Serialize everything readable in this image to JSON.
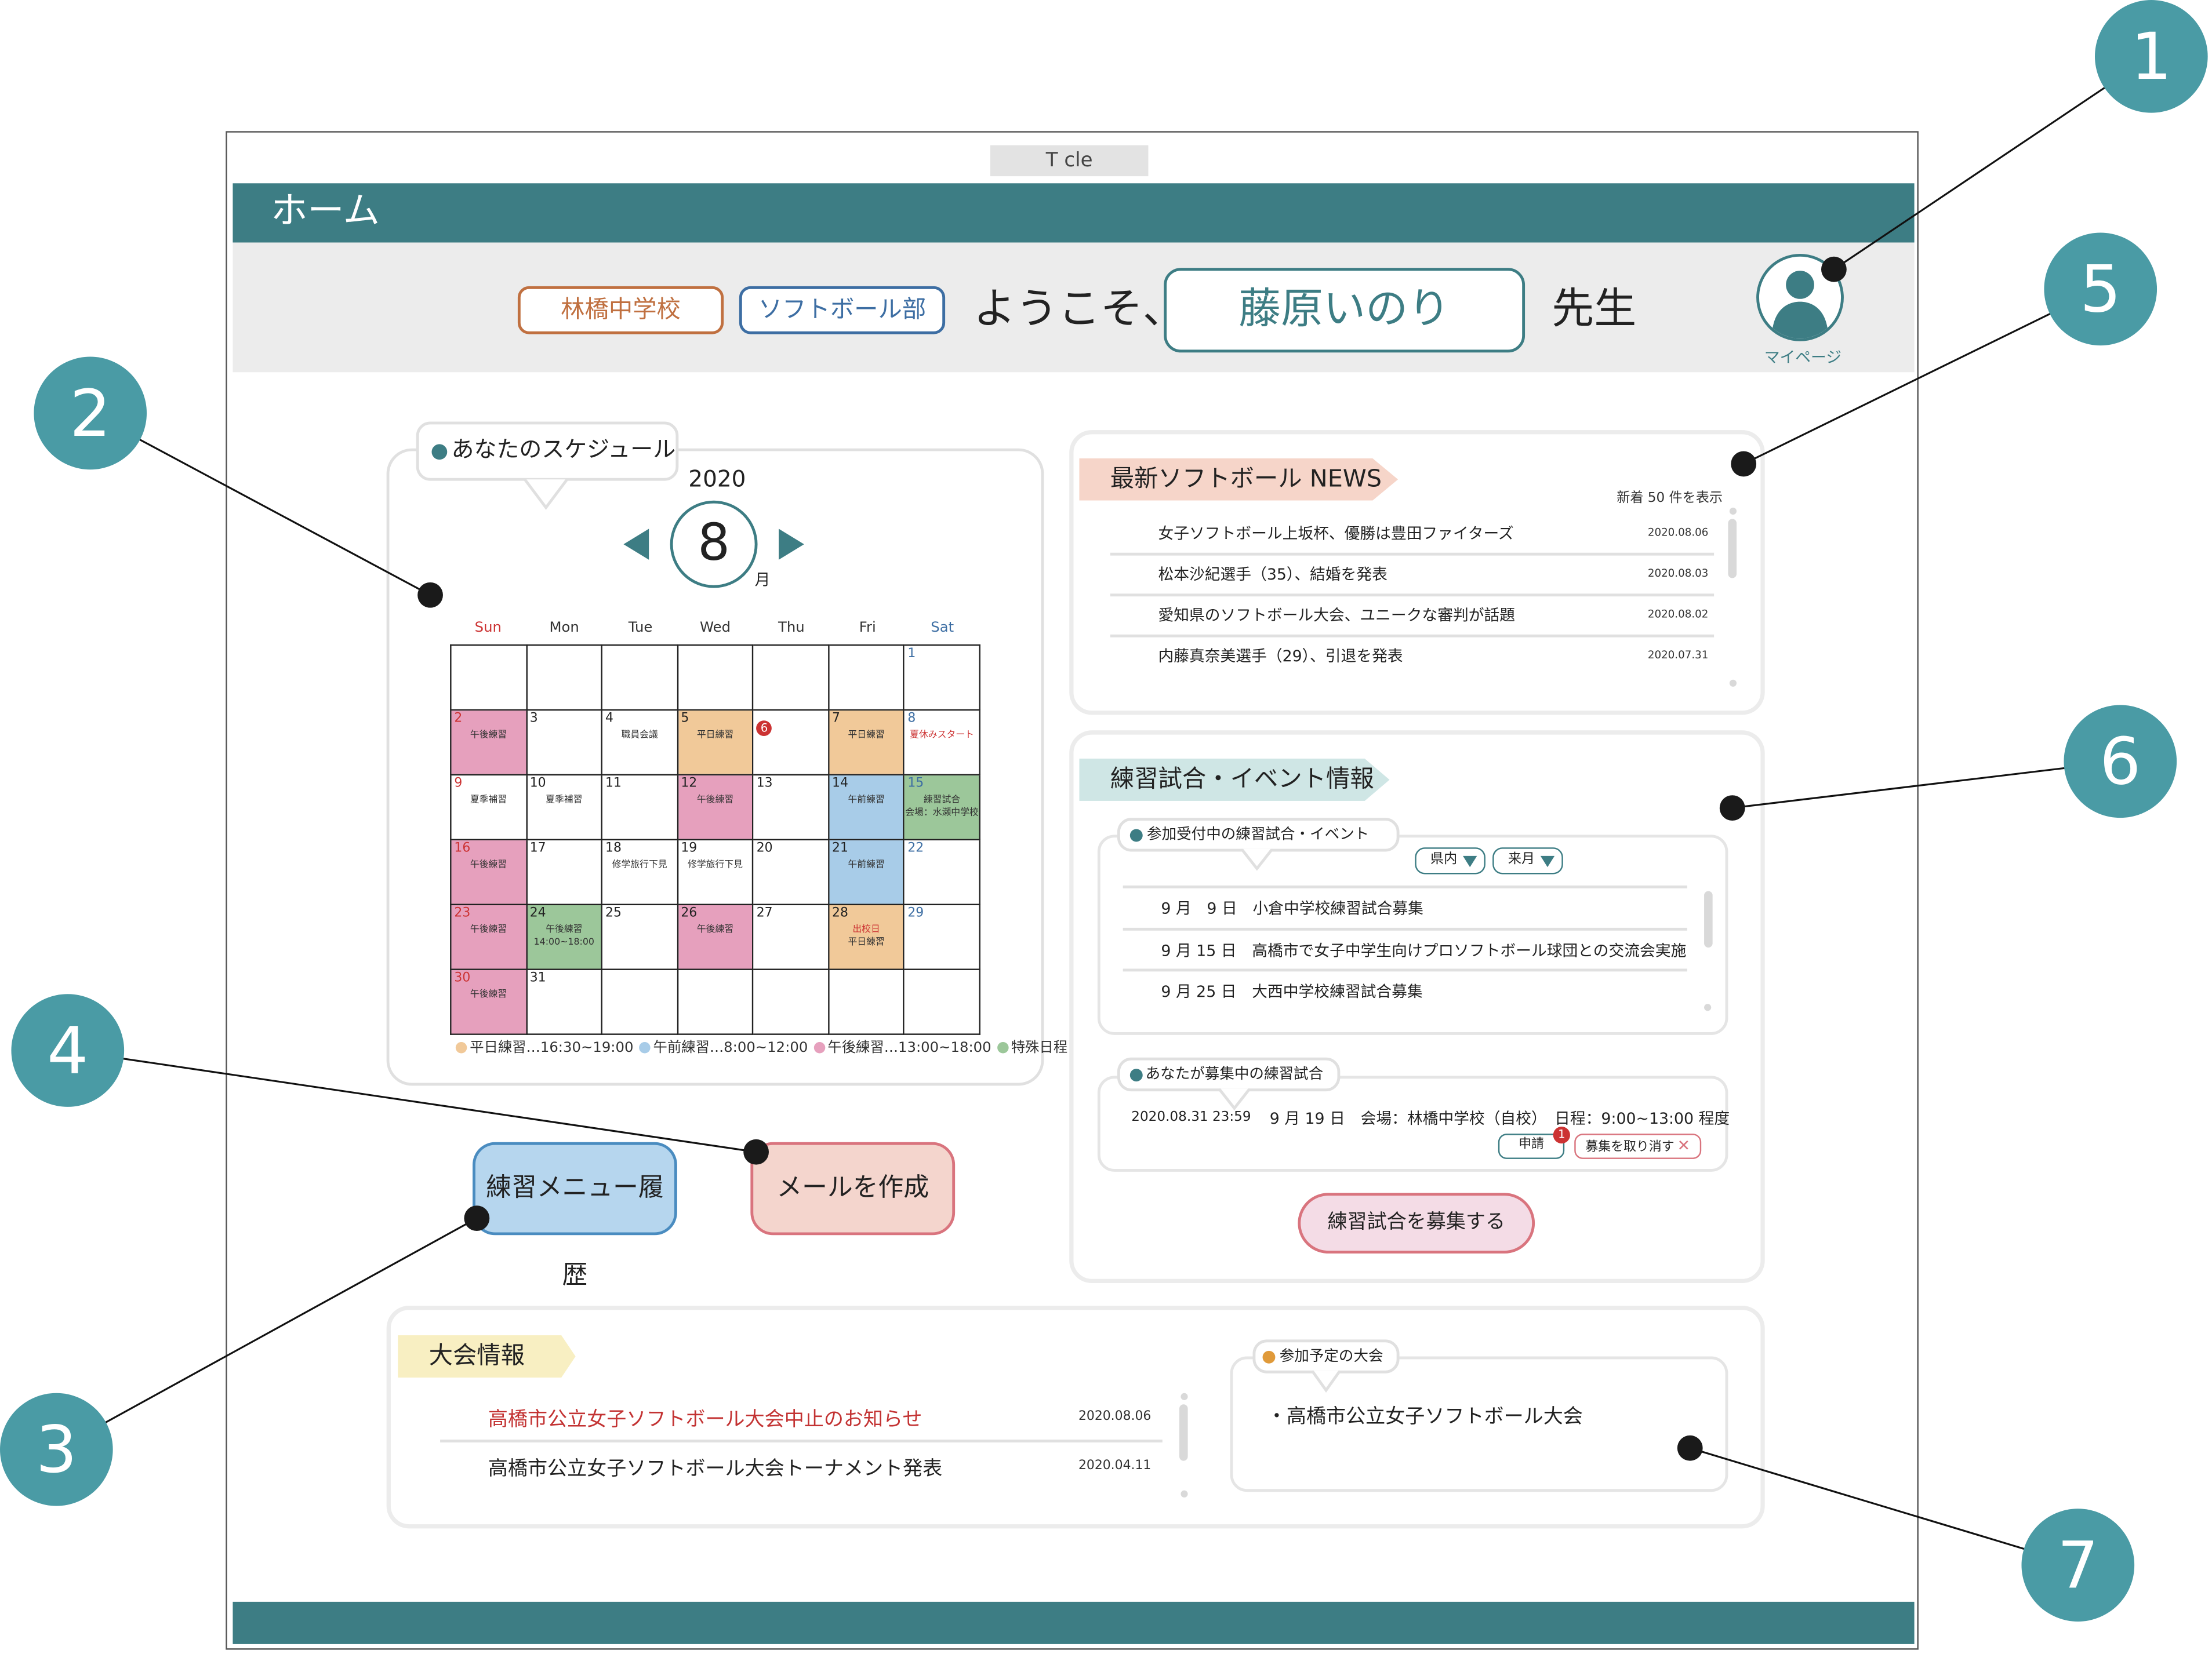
{
  "app": {
    "window_title": "T cle",
    "page_title": "ホーム"
  },
  "header": {
    "school": "林橋中学校",
    "club": "ソフトボール部",
    "welcome": "ようこそ、",
    "user_name": "藤原いのり",
    "honorific": "先生",
    "mypage_label": "マイページ",
    "avatar_icon": "user-avatar-icon"
  },
  "schedule": {
    "title": "あなたのスケジュール",
    "year": "2020",
    "month": "8",
    "month_suffix": "月",
    "weekdays": [
      "Sun",
      "Mon",
      "Tue",
      "Wed",
      "Thu",
      "Fri",
      "Sat"
    ],
    "weeks": [
      [
        {
          "d": ""
        },
        {
          "d": ""
        },
        {
          "d": ""
        },
        {
          "d": ""
        },
        {
          "d": ""
        },
        {
          "d": ""
        },
        {
          "d": "1"
        }
      ],
      [
        {
          "d": "2",
          "e": "午後練習",
          "c": "pink"
        },
        {
          "d": "3"
        },
        {
          "d": "4",
          "e": "職員会議"
        },
        {
          "d": "5",
          "e": "平日練習",
          "c": "orange"
        },
        {
          "d": "6",
          "badge": true
        },
        {
          "d": "7",
          "e": "平日練習",
          "c": "orange"
        },
        {
          "d": "8",
          "e": "夏休みスタート",
          "red": true
        }
      ],
      [
        {
          "d": "9",
          "e": "夏季補習"
        },
        {
          "d": "10",
          "e": "夏季補習"
        },
        {
          "d": "11"
        },
        {
          "d": "12",
          "e": "午後練習",
          "c": "pink"
        },
        {
          "d": "13"
        },
        {
          "d": "14",
          "e": "午前練習",
          "c": "blue"
        },
        {
          "d": "15",
          "e": "練習試合\n会場：水瀬中学校",
          "c": "green"
        }
      ],
      [
        {
          "d": "16",
          "e": "午後練習",
          "c": "pink"
        },
        {
          "d": "17"
        },
        {
          "d": "18",
          "e": "修学旅行下見"
        },
        {
          "d": "19",
          "e": "修学旅行下見"
        },
        {
          "d": "20"
        },
        {
          "d": "21",
          "e": "午前練習",
          "c": "blue"
        },
        {
          "d": "22"
        }
      ],
      [
        {
          "d": "23",
          "e": "午後練習",
          "c": "pink"
        },
        {
          "d": "24",
          "e": "午後練習\n14:00~18:00",
          "c": "green"
        },
        {
          "d": "25"
        },
        {
          "d": "26",
          "e": "午後練習",
          "c": "pink"
        },
        {
          "d": "27"
        },
        {
          "d": "28",
          "e": "出校日\n平日練習",
          "c": "orange",
          "red_first": true
        },
        {
          "d": "29"
        }
      ],
      [
        {
          "d": "30",
          "e": "午後練習",
          "c": "pink"
        },
        {
          "d": "31"
        },
        {
          "d": ""
        },
        {
          "d": ""
        },
        {
          "d": ""
        },
        {
          "d": ""
        },
        {
          "d": ""
        }
      ]
    ],
    "legend": [
      {
        "label": "平日練習…16:30~19:00",
        "color": "#f1c999"
      },
      {
        "label": "午前練習…8:00~12:00",
        "color": "#a8cce8"
      },
      {
        "label": "午後練習…13:00~18:00",
        "color": "#e6a0bd"
      },
      {
        "label": "特殊日程",
        "color": "#9cc79a"
      }
    ]
  },
  "buttons": {
    "history": "練習メニュー履歴",
    "mail": "メールを作成"
  },
  "news": {
    "title": "最新ソフトボール NEWS",
    "count_label": "新着 50 件を表示",
    "items": [
      {
        "title": "女子ソフトボール上坂杯、優勝は豊田ファイターズ",
        "date": "2020.08.06"
      },
      {
        "title": "松本沙紀選手（35）、結婚を発表",
        "date": "2020.08.03"
      },
      {
        "title": "愛知県のソフトボール大会、ユニークな審判が話題",
        "date": "2020.08.02"
      },
      {
        "title": "内藤真奈美選手（29）、引退を発表",
        "date": "2020.07.31"
      }
    ]
  },
  "events": {
    "title": "練習試合・イベント情報",
    "recruiting_title": "参加受付中の練習試合・イベント",
    "filter_region": "県内",
    "filter_month": "来月",
    "items": [
      "9 月　9 日　小倉中学校練習試合募集",
      "9 月 15 日　高橋市で女子中学生向けプロソフトボール球団との交流会実施",
      "9 月 25 日　大西中学校練習試合募集"
    ],
    "mine_title": "あなたが募集中の練習試合",
    "mine_deadline": "2020.08.31 23:59",
    "mine_info": "9 月 19 日　会場：林橋中学校（自校）　日程：9:00~13:00 程度",
    "apply_label": "申請",
    "apply_badge": "1",
    "cancel_label": "募集を取り消す",
    "recruit_button": "練習試合を募集する"
  },
  "tournament": {
    "title": "大会情報",
    "items": [
      {
        "title": "高橋市公立女子ソフトボール大会中止のお知らせ",
        "date": "2020.08.06",
        "alert": true
      },
      {
        "title": "高橋市公立女子ソフトボール大会トーナメント発表",
        "date": "2020.04.11"
      }
    ],
    "planned_title": "参加予定の大会",
    "planned_item": "・高橋市公立女子ソフトボール大会"
  },
  "callouts": [
    "1",
    "2",
    "3",
    "4",
    "5",
    "6",
    "7"
  ],
  "colors": {
    "brand": "#3d7d84",
    "callout": "#4a9ba5",
    "alert": "#c33333"
  }
}
